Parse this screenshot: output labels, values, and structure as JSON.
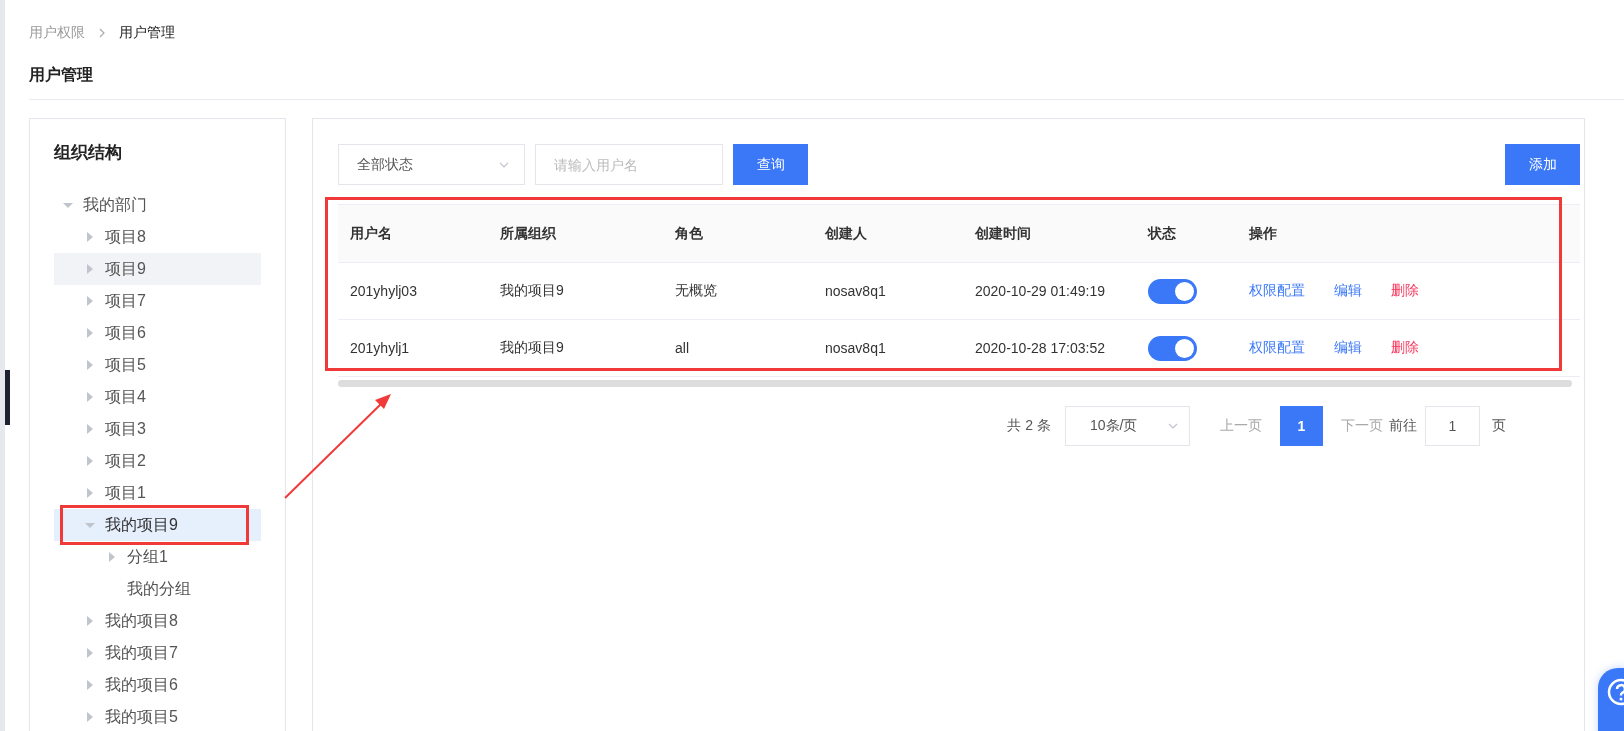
{
  "breadcrumb": [
    {
      "label": "用户权限",
      "current": false
    },
    {
      "label": "用户管理",
      "current": true
    }
  ],
  "page_title": "用户管理",
  "org_panel": {
    "title": "组织结构",
    "tree": [
      {
        "label": "我的部门",
        "kind": "branch",
        "expanded": true,
        "selected": false,
        "hovered": false,
        "children": [
          {
            "label": "项目8",
            "kind": "branch",
            "expanded": false,
            "selected": false,
            "hovered": false
          },
          {
            "label": "项目9",
            "kind": "branch",
            "expanded": false,
            "selected": false,
            "hovered": true
          },
          {
            "label": "项目7",
            "kind": "branch",
            "expanded": false,
            "selected": false,
            "hovered": false
          },
          {
            "label": "项目6",
            "kind": "branch",
            "expanded": false,
            "selected": false,
            "hovered": false
          },
          {
            "label": "项目5",
            "kind": "branch",
            "expanded": false,
            "selected": false,
            "hovered": false
          },
          {
            "label": "项目4",
            "kind": "branch",
            "expanded": false,
            "selected": false,
            "hovered": false
          },
          {
            "label": "项目3",
            "kind": "branch",
            "expanded": false,
            "selected": false,
            "hovered": false
          },
          {
            "label": "项目2",
            "kind": "branch",
            "expanded": false,
            "selected": false,
            "hovered": false
          },
          {
            "label": "项目1",
            "kind": "branch",
            "expanded": false,
            "selected": false,
            "hovered": false
          },
          {
            "label": "我的项目9",
            "kind": "branch",
            "expanded": true,
            "selected": true,
            "hovered": false,
            "children": [
              {
                "label": "分组1",
                "kind": "branch",
                "expanded": false,
                "selected": false,
                "hovered": false
              },
              {
                "label": "我的分组",
                "kind": "leaf",
                "selected": false,
                "hovered": false
              }
            ]
          },
          {
            "label": "我的项目8",
            "kind": "branch",
            "expanded": false,
            "selected": false,
            "hovered": false
          },
          {
            "label": "我的项目7",
            "kind": "branch",
            "expanded": false,
            "selected": false,
            "hovered": false
          },
          {
            "label": "我的项目6",
            "kind": "branch",
            "expanded": false,
            "selected": false,
            "hovered": false
          },
          {
            "label": "我的项目5",
            "kind": "branch",
            "expanded": false,
            "selected": false,
            "hovered": false
          }
        ]
      }
    ]
  },
  "filters": {
    "status_select": "全部状态",
    "username": {
      "placeholder": "请输入用户名"
    },
    "search_button": "查询",
    "add_button": "添加"
  },
  "table": {
    "columns": [
      "用户名",
      "所属组织",
      "角色",
      "创建人",
      "创建时间",
      "状态",
      "操作"
    ],
    "rows": [
      {
        "username": "201yhylj03",
        "org": "我的项目9",
        "role": "无概览",
        "creator": "nosav8q1",
        "created": "2020-10-29 01:49:19",
        "enabled": true,
        "actions": [
          {
            "label": "权限配置",
            "kind": "normal"
          },
          {
            "label": "编辑",
            "kind": "normal"
          },
          {
            "label": "删除",
            "kind": "danger"
          }
        ]
      },
      {
        "username": "201yhylj1",
        "org": "我的项目9",
        "role": "all",
        "creator": "nosav8q1",
        "created": "2020-10-28 17:03:52",
        "enabled": true,
        "actions": [
          {
            "label": "权限配置",
            "kind": "normal"
          },
          {
            "label": "编辑",
            "kind": "normal"
          },
          {
            "label": "删除",
            "kind": "danger"
          }
        ]
      }
    ]
  },
  "pager": {
    "total": "共 2 条",
    "page_size": "10条/页",
    "prev": {
      "label": "上一页",
      "disabled": true
    },
    "pages": [
      {
        "label": "1",
        "selected": true
      }
    ],
    "next": {
      "label": "下一页",
      "disabled": true
    },
    "goto_label": "前往",
    "goto_value": "1",
    "goto_suffix": "页"
  }
}
